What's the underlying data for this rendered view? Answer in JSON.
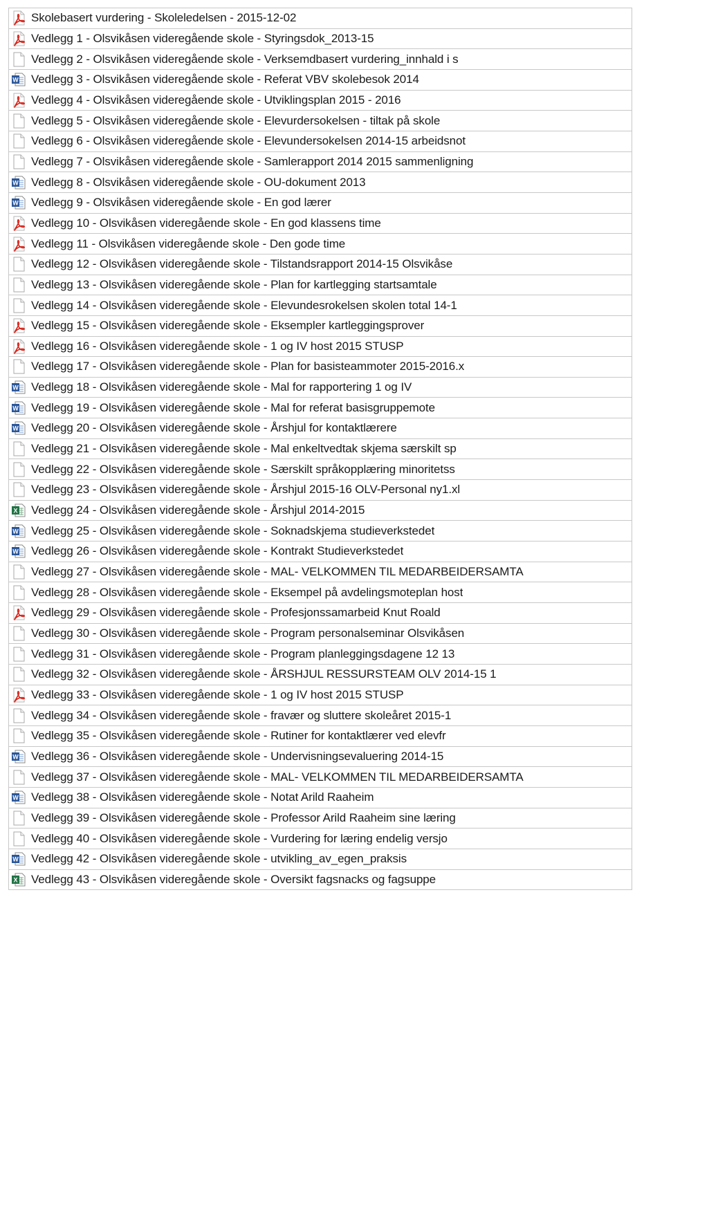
{
  "files": [
    {
      "icon": "pdf-icon",
      "name": "Skolebasert vurdering - Skoleledelsen - 2015-12-02"
    },
    {
      "icon": "pdf-icon",
      "name": "Vedlegg 1 - Olsvikåsen videregående skole - Styringsdok_2013-15"
    },
    {
      "icon": "generic-file-icon",
      "name": "Vedlegg 2 - Olsvikåsen videregående skole - Verksemdbasert vurdering_innhald i s"
    },
    {
      "icon": "word-doc-icon",
      "name": "Vedlegg 3 - Olsvikåsen videregående skole - Referat VBV  skolebesok  2014"
    },
    {
      "icon": "pdf-icon",
      "name": "Vedlegg 4 - Olsvikåsen videregående skole - Utviklingsplan 2015 - 2016"
    },
    {
      "icon": "generic-file-icon",
      "name": "Vedlegg 5 - Olsvikåsen videregående skole - Elevurdersokelsen - tiltak på skole"
    },
    {
      "icon": "generic-file-icon",
      "name": "Vedlegg 6 - Olsvikåsen videregående skole - Elevundersokelsen 2014-15 arbeidsnot"
    },
    {
      "icon": "generic-file-icon",
      "name": "Vedlegg 7 - Olsvikåsen videregående skole - Samlerapport 2014 2015 sammenligning"
    },
    {
      "icon": "word-doc-icon",
      "name": "Vedlegg 8 - Olsvikåsen videregående skole - OU-dokument 2013"
    },
    {
      "icon": "word-doc-icon",
      "name": "Vedlegg 9 - Olsvikåsen videregående skole - En god lærer"
    },
    {
      "icon": "pdf-icon",
      "name": "Vedlegg 10 - Olsvikåsen videregående skole - En god klassens time"
    },
    {
      "icon": "pdf-icon",
      "name": "Vedlegg 11 - Olsvikåsen videregående skole - Den gode time"
    },
    {
      "icon": "generic-file-icon",
      "name": "Vedlegg 12 - Olsvikåsen videregående skole - Tilstandsrapport 2014-15  Olsvikåse"
    },
    {
      "icon": "generic-file-icon",
      "name": "Vedlegg 13 - Olsvikåsen videregående skole - Plan for kartlegging  startsamtale"
    },
    {
      "icon": "generic-file-icon",
      "name": "Vedlegg 14 - Olsvikåsen videregående skole - Elevundesrokelsen skolen total 14-1"
    },
    {
      "icon": "pdf-icon",
      "name": "Vedlegg 15 - Olsvikåsen videregående skole - Eksempler kartleggingsprover"
    },
    {
      "icon": "pdf-icon",
      "name": "Vedlegg 16 - Olsvikåsen videregående skole - 1 og IV host 2015 STUSP"
    },
    {
      "icon": "generic-file-icon",
      "name": "Vedlegg 17 - Olsvikåsen videregående skole - Plan for basisteammoter 2015-2016.x"
    },
    {
      "icon": "word-doc-icon",
      "name": "Vedlegg 18 - Olsvikåsen videregående skole - Mal for rapportering 1 og IV"
    },
    {
      "icon": "word-doc-icon",
      "name": "Vedlegg 19 - Olsvikåsen videregående skole - Mal for referat basisgruppemote"
    },
    {
      "icon": "word-doc-icon",
      "name": "Vedlegg 20 - Olsvikåsen videregående skole - Årshjul for kontaktlærere"
    },
    {
      "icon": "generic-file-icon",
      "name": "Vedlegg 21 - Olsvikåsen videregående skole - Mal enkeltvedtak skjema særskilt sp"
    },
    {
      "icon": "generic-file-icon",
      "name": "Vedlegg 22 - Olsvikåsen videregående skole - Særskilt språkopplæring minoritetss"
    },
    {
      "icon": "generic-file-icon",
      "name": "Vedlegg 23 - Olsvikåsen videregående skole - Årshjul 2015-16 OLV-Personal ny1.xl"
    },
    {
      "icon": "excel-sheet-icon",
      "name": "Vedlegg 24 - Olsvikåsen videregående skole - Årshjul 2014-2015"
    },
    {
      "icon": "word-doc-icon",
      "name": "Vedlegg 25 - Olsvikåsen videregående skole - Soknadskjema studieverkstedet"
    },
    {
      "icon": "word-doc-icon",
      "name": "Vedlegg 26 - Olsvikåsen videregående skole - Kontrakt Studieverkstedet"
    },
    {
      "icon": "generic-file-icon",
      "name": "Vedlegg 27 - Olsvikåsen videregående skole - MAL- VELKOMMEN TIL MEDARBEIDERSAMTA"
    },
    {
      "icon": "generic-file-icon",
      "name": "Vedlegg 28 - Olsvikåsen videregående skole - Eksempel på avdelingsmoteplan host"
    },
    {
      "icon": "pdf-icon",
      "name": "Vedlegg 29 - Olsvikåsen videregående skole - Profesjonssamarbeid Knut Roald"
    },
    {
      "icon": "generic-file-icon",
      "name": "Vedlegg 30 - Olsvikåsen videregående skole - Program personalseminar Olsvikåsen"
    },
    {
      "icon": "generic-file-icon",
      "name": "Vedlegg 31 - Olsvikåsen videregående skole - Program planleggingsdagene 12   13"
    },
    {
      "icon": "generic-file-icon",
      "name": "Vedlegg 32 - Olsvikåsen videregående skole - ÅRSHJUL RESSURSTEAM OLV 2014-15  1"
    },
    {
      "icon": "pdf-icon",
      "name": "Vedlegg 33 - Olsvikåsen videregående skole - 1 og IV host 2015 STUSP"
    },
    {
      "icon": "generic-file-icon",
      "name": "Vedlegg 34 - Olsvikåsen videregående skole - fravær og sluttere skoleåret 2015-1"
    },
    {
      "icon": "generic-file-icon",
      "name": "Vedlegg 35 - Olsvikåsen videregående skole - Rutiner for kontaktlærer ved elevfr"
    },
    {
      "icon": "word-doc-icon",
      "name": "Vedlegg 36 - Olsvikåsen videregående skole - Undervisningsevaluering 2014-15"
    },
    {
      "icon": "generic-file-icon",
      "name": "Vedlegg 37 - Olsvikåsen videregående skole - MAL- VELKOMMEN TIL MEDARBEIDERSAMTA"
    },
    {
      "icon": "word-doc-icon",
      "name": "Vedlegg 38 - Olsvikåsen videregående skole - Notat Arild Raaheim"
    },
    {
      "icon": "generic-file-icon",
      "name": "Vedlegg 39 - Olsvikåsen videregående skole - Professor Arild Raaheim sine læring"
    },
    {
      "icon": "generic-file-icon",
      "name": "Vedlegg 40 - Olsvikåsen videregående skole - Vurdering for læring endelig versjo"
    },
    {
      "icon": "word-doc-icon",
      "name": "Vedlegg 42 - Olsvikåsen videregående skole - utvikling_av_egen_praksis"
    },
    {
      "icon": "excel-sheet-icon",
      "name": "Vedlegg 43 - Olsvikåsen videregående skole - Oversikt fagsnacks og fagsuppe"
    }
  ],
  "colors": {
    "pdf_red": "#d9261c",
    "word_blue": "#2b579a",
    "excel_green": "#217346",
    "border": "#c8c8c8"
  }
}
